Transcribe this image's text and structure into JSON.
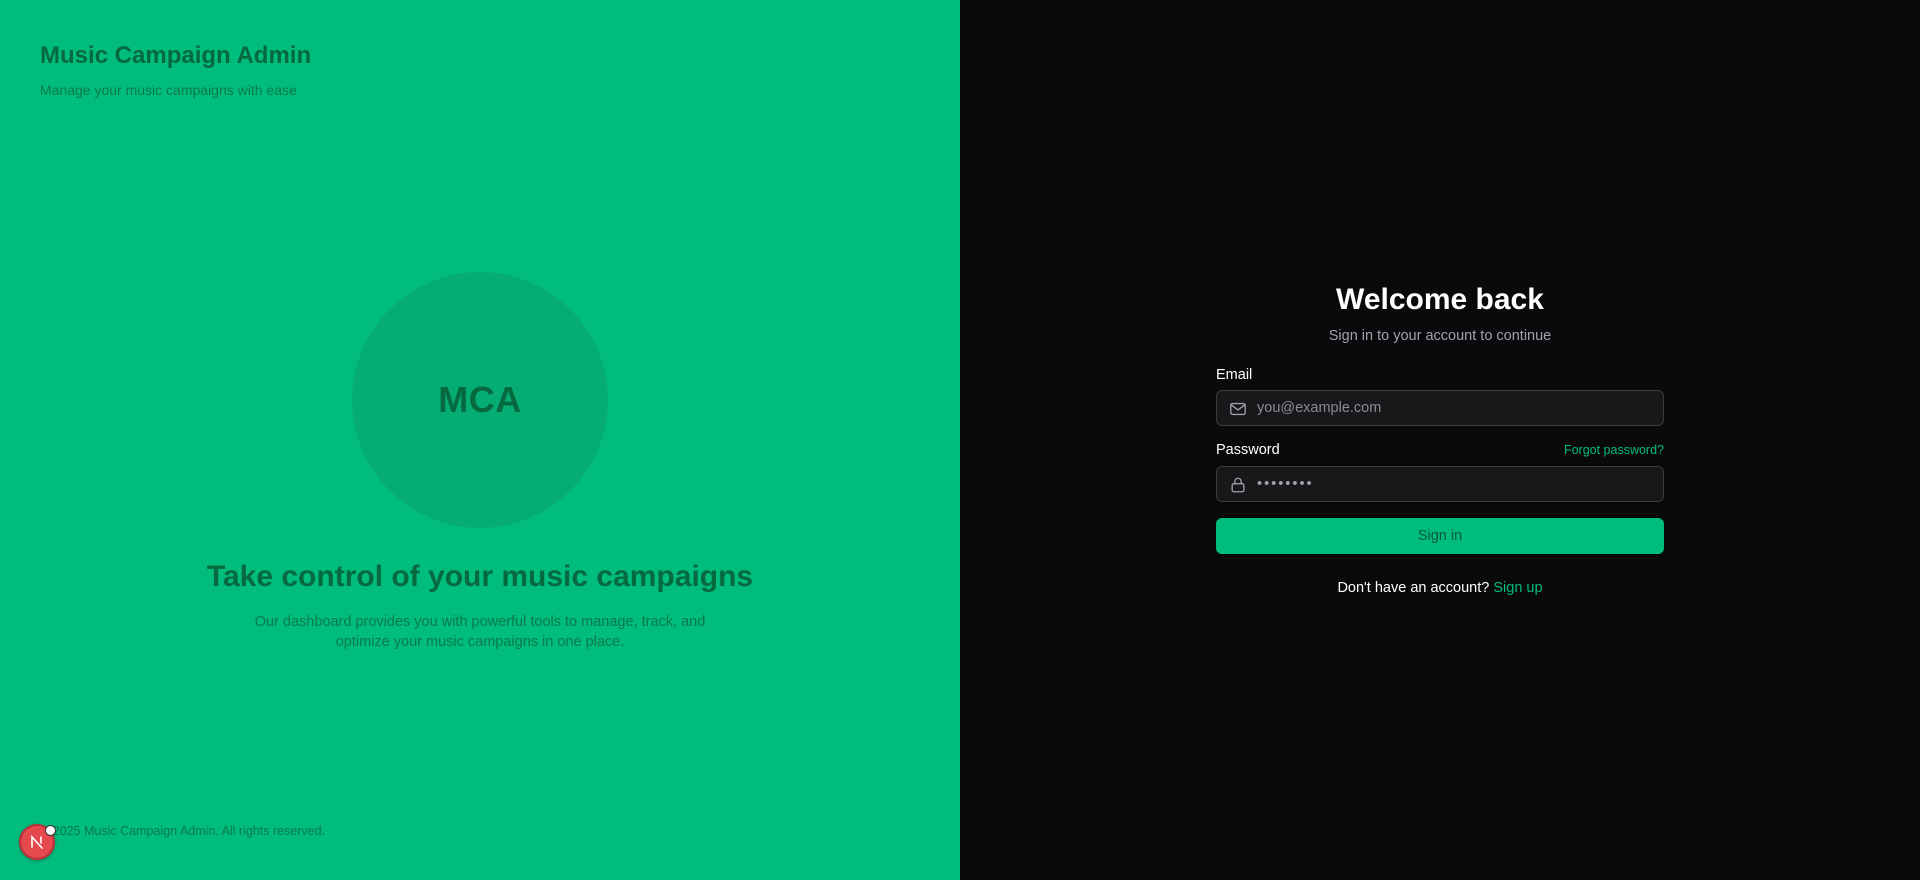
{
  "brand": {
    "title": "Music Campaign Admin",
    "subtitle": "Manage your music campaigns with ease",
    "logo_text": "MCA",
    "accent_color": "#00bc7d"
  },
  "hero": {
    "title": "Take control of your music campaigns",
    "description": "Our dashboard provides you with powerful tools to manage, track, and optimize your music campaigns in one place."
  },
  "footer": {
    "copyright": "2025 Music Campaign Admin. All rights reserved."
  },
  "dev_badge": {
    "letter": "N",
    "color": "#e5484d"
  },
  "login": {
    "heading": "Welcome back",
    "subheading": "Sign in to your account to continue",
    "email": {
      "label": "Email",
      "placeholder": "you@example.com",
      "value": "",
      "icon": "mail-icon"
    },
    "password": {
      "label": "Password",
      "forgot_label": "Forgot password?",
      "value": "••••••••",
      "icon": "lock-icon"
    },
    "submit_label": "Sign in",
    "signup_prompt": "Don't have an account?",
    "signup_label": "Sign up"
  }
}
